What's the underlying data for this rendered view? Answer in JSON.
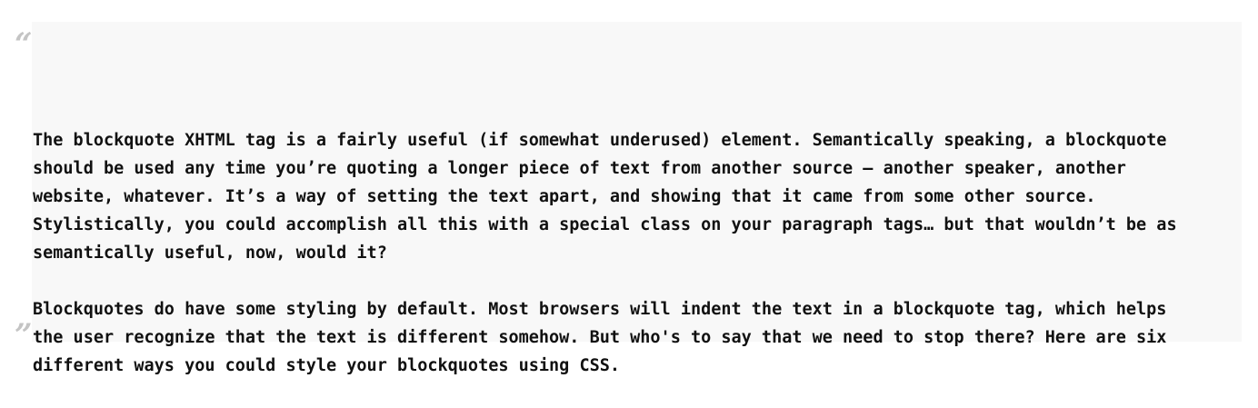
{
  "quote": {
    "open_mark": "“",
    "close_mark": "”",
    "paragraphs": [
      {
        "lines": [
          "The blockquote XHTML tag is a fairly useful (if somewhat underused) element. Semantically speaking, a blockquote",
          "should be used any time you’re quoting a longer piece of text from another source – another speaker, another",
          "website, whatever. It’s a way of setting the text apart, and showing that it came from some other source.",
          "Stylistically, you could accomplish all this with a special class on your paragraph tags… but that wouldn’t be as",
          "semantically useful, now, would it?"
        ]
      },
      {
        "lines": [
          "Blockquotes do have some styling by default. Most browsers will indent the text in a blockquote tag, which helps",
          "the user recognize that the text is different somehow. But who's to say that we need to stop there? Here are six",
          "different ways you could style your blockquotes using CSS."
        ]
      }
    ]
  },
  "colors": {
    "background": "#f8f8f8",
    "quote_mark": "#c4c4c4",
    "text": "#111111"
  }
}
